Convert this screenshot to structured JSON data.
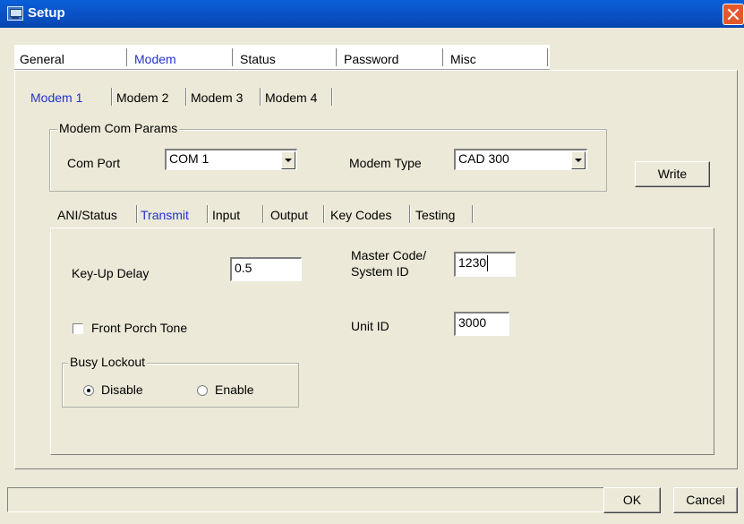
{
  "window": {
    "title": "Setup"
  },
  "main_tabs": [
    {
      "label": "General"
    },
    {
      "label": "Modem"
    },
    {
      "label": "Status"
    },
    {
      "label": "Password"
    },
    {
      "label": "Misc"
    }
  ],
  "modem_tabs": [
    {
      "label": "Modem 1"
    },
    {
      "label": "Modem 2"
    },
    {
      "label": "Modem 3"
    },
    {
      "label": "Modem 4"
    }
  ],
  "com_params": {
    "group_label": "Modem Com Params",
    "com_port_label": "Com Port",
    "com_port_value": "COM 1",
    "modem_type_label": "Modem Type",
    "modem_type_value": "CAD 300",
    "write_button": "Write"
  },
  "sub_tabs": [
    {
      "label": "ANI/Status"
    },
    {
      "label": "Transmit"
    },
    {
      "label": "Input"
    },
    {
      "label": "Output"
    },
    {
      "label": "Key Codes"
    },
    {
      "label": "Testing"
    }
  ],
  "transmit": {
    "key_up_delay_label": "Key-Up Delay",
    "key_up_delay_value": "0.5",
    "master_code_label_line1": "Master Code/",
    "master_code_label_line2": "System ID",
    "master_code_value": "1230",
    "front_porch_label": "Front Porch Tone",
    "front_porch_checked": false,
    "unit_id_label": "Unit ID",
    "unit_id_value": "3000",
    "busy_lockout": {
      "group_label": "Busy Lockout",
      "options": [
        "Disable",
        "Enable"
      ],
      "selected": "Disable"
    }
  },
  "footer": {
    "status_text": "",
    "ok_button": "OK",
    "cancel_button": "Cancel"
  },
  "icons": {
    "app_icon": "computer-icon",
    "close_icon": "close-icon",
    "dropdown_icon": "chevron-down-icon"
  }
}
